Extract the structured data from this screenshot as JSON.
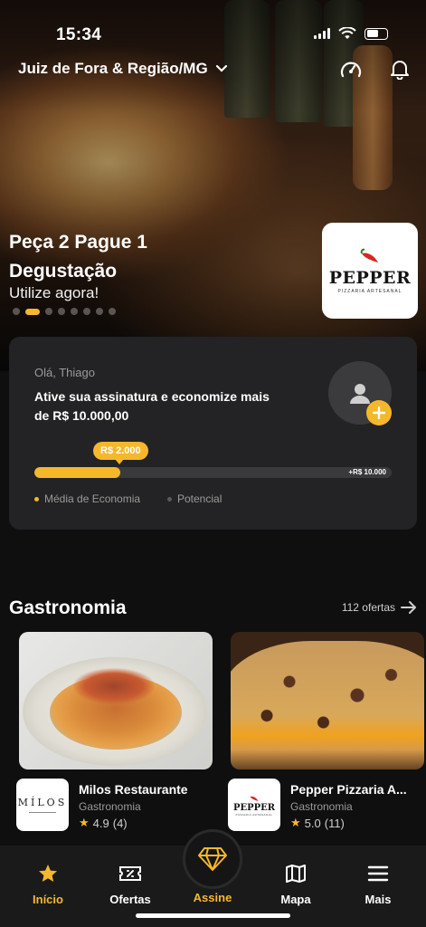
{
  "status": {
    "time": "15:34"
  },
  "header": {
    "location": "Juiz de Fora & Região/MG"
  },
  "hero": {
    "title": "Peça 2 Pague 1 Degustação",
    "subtitle": "Utilize agora!",
    "slides_total": 8,
    "active_slide": 2,
    "logo": {
      "name": "PEPPER",
      "tagline": "PIZZARIA ARTESANAL"
    }
  },
  "savings": {
    "greeting": "Olá, Thiago",
    "headline": "Ative sua assinatura e economize mais de  R$ 10.000,00",
    "current_label": "R$ 2.000",
    "max_label": "+R$ 10.000",
    "progress_fraction": 0.24,
    "legend_average": "Média de Economia",
    "legend_potential": "Potencial",
    "accent": "#f5b82b"
  },
  "section": {
    "title": "Gastronomia",
    "link": "112 ofertas"
  },
  "offers": [
    {
      "name": "Milos Restaurante",
      "logo_text": "MÍLOS",
      "category": "Gastronomia",
      "rating": "4.9",
      "reviews": "(4)"
    },
    {
      "name": "Pepper Pizzaria A...",
      "logo_text": "PEPPER",
      "logo_tag": "PIZZARIA ARTESANAL",
      "category": "Gastronomia",
      "rating": "5.0",
      "reviews": "(11)"
    }
  ],
  "tabs": [
    {
      "label": "Início",
      "icon": "star-icon"
    },
    {
      "label": "Ofertas",
      "icon": "ticket-icon"
    },
    {
      "label": "Assine",
      "icon": "diamond-icon"
    },
    {
      "label": "Mapa",
      "icon": "map-icon"
    },
    {
      "label": "Mais",
      "icon": "menu-icon"
    }
  ]
}
